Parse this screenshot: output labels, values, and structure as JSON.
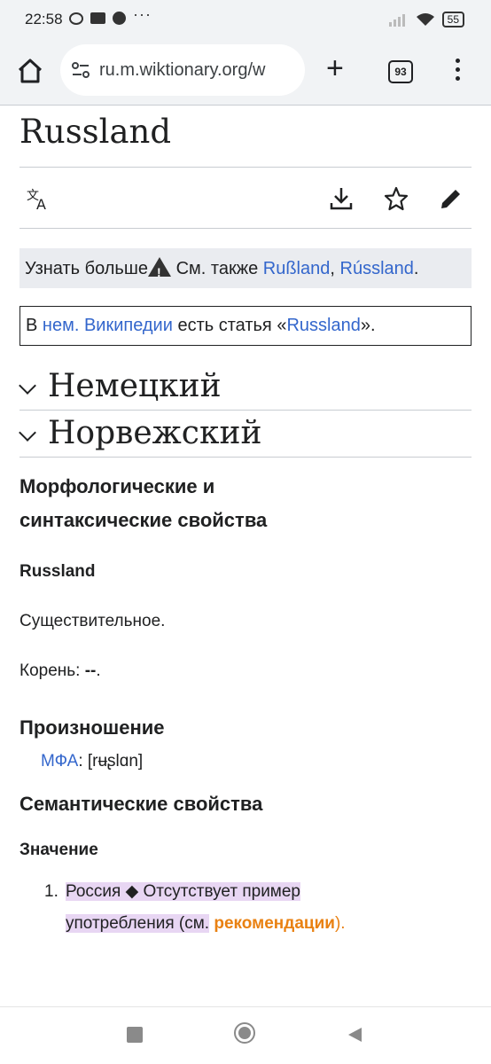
{
  "status": {
    "time": "22:58",
    "battery": "55"
  },
  "browser": {
    "url": "ru.m.wiktionary.org/w",
    "tab_count": "93"
  },
  "page": {
    "title": "Russland",
    "notice": {
      "learn_more": "Узнать больше",
      "see_also": "См. также",
      "link1": "Rußland",
      "sep": ",",
      "link2": "Rússland",
      "end": "."
    },
    "wiki": {
      "prefix": "В",
      "link": "нем. Википедии",
      "middle": "есть статья «",
      "article": "Russland",
      "suffix": "»."
    },
    "languages": [
      "Немецкий",
      "Норвежский"
    ],
    "morph_heading": "Морфологические и синтаксические свойства",
    "word": "Russland",
    "pos": "Существительное.",
    "root_label": "Корень:",
    "root_value": "--",
    "root_end": ".",
    "pron_heading": "Произношение",
    "ipa_label": "МФА",
    "ipa_value": ": [rʉʂlɑn]",
    "sem_heading": "Семантические свойства",
    "meaning_heading": "Значение",
    "definition": {
      "number": "1.",
      "word": "Россия",
      "diamond": "◆",
      "text1": "Отсутствует пример",
      "text2": "употребления (см.",
      "link": "рекомендации",
      "close": ")."
    }
  }
}
